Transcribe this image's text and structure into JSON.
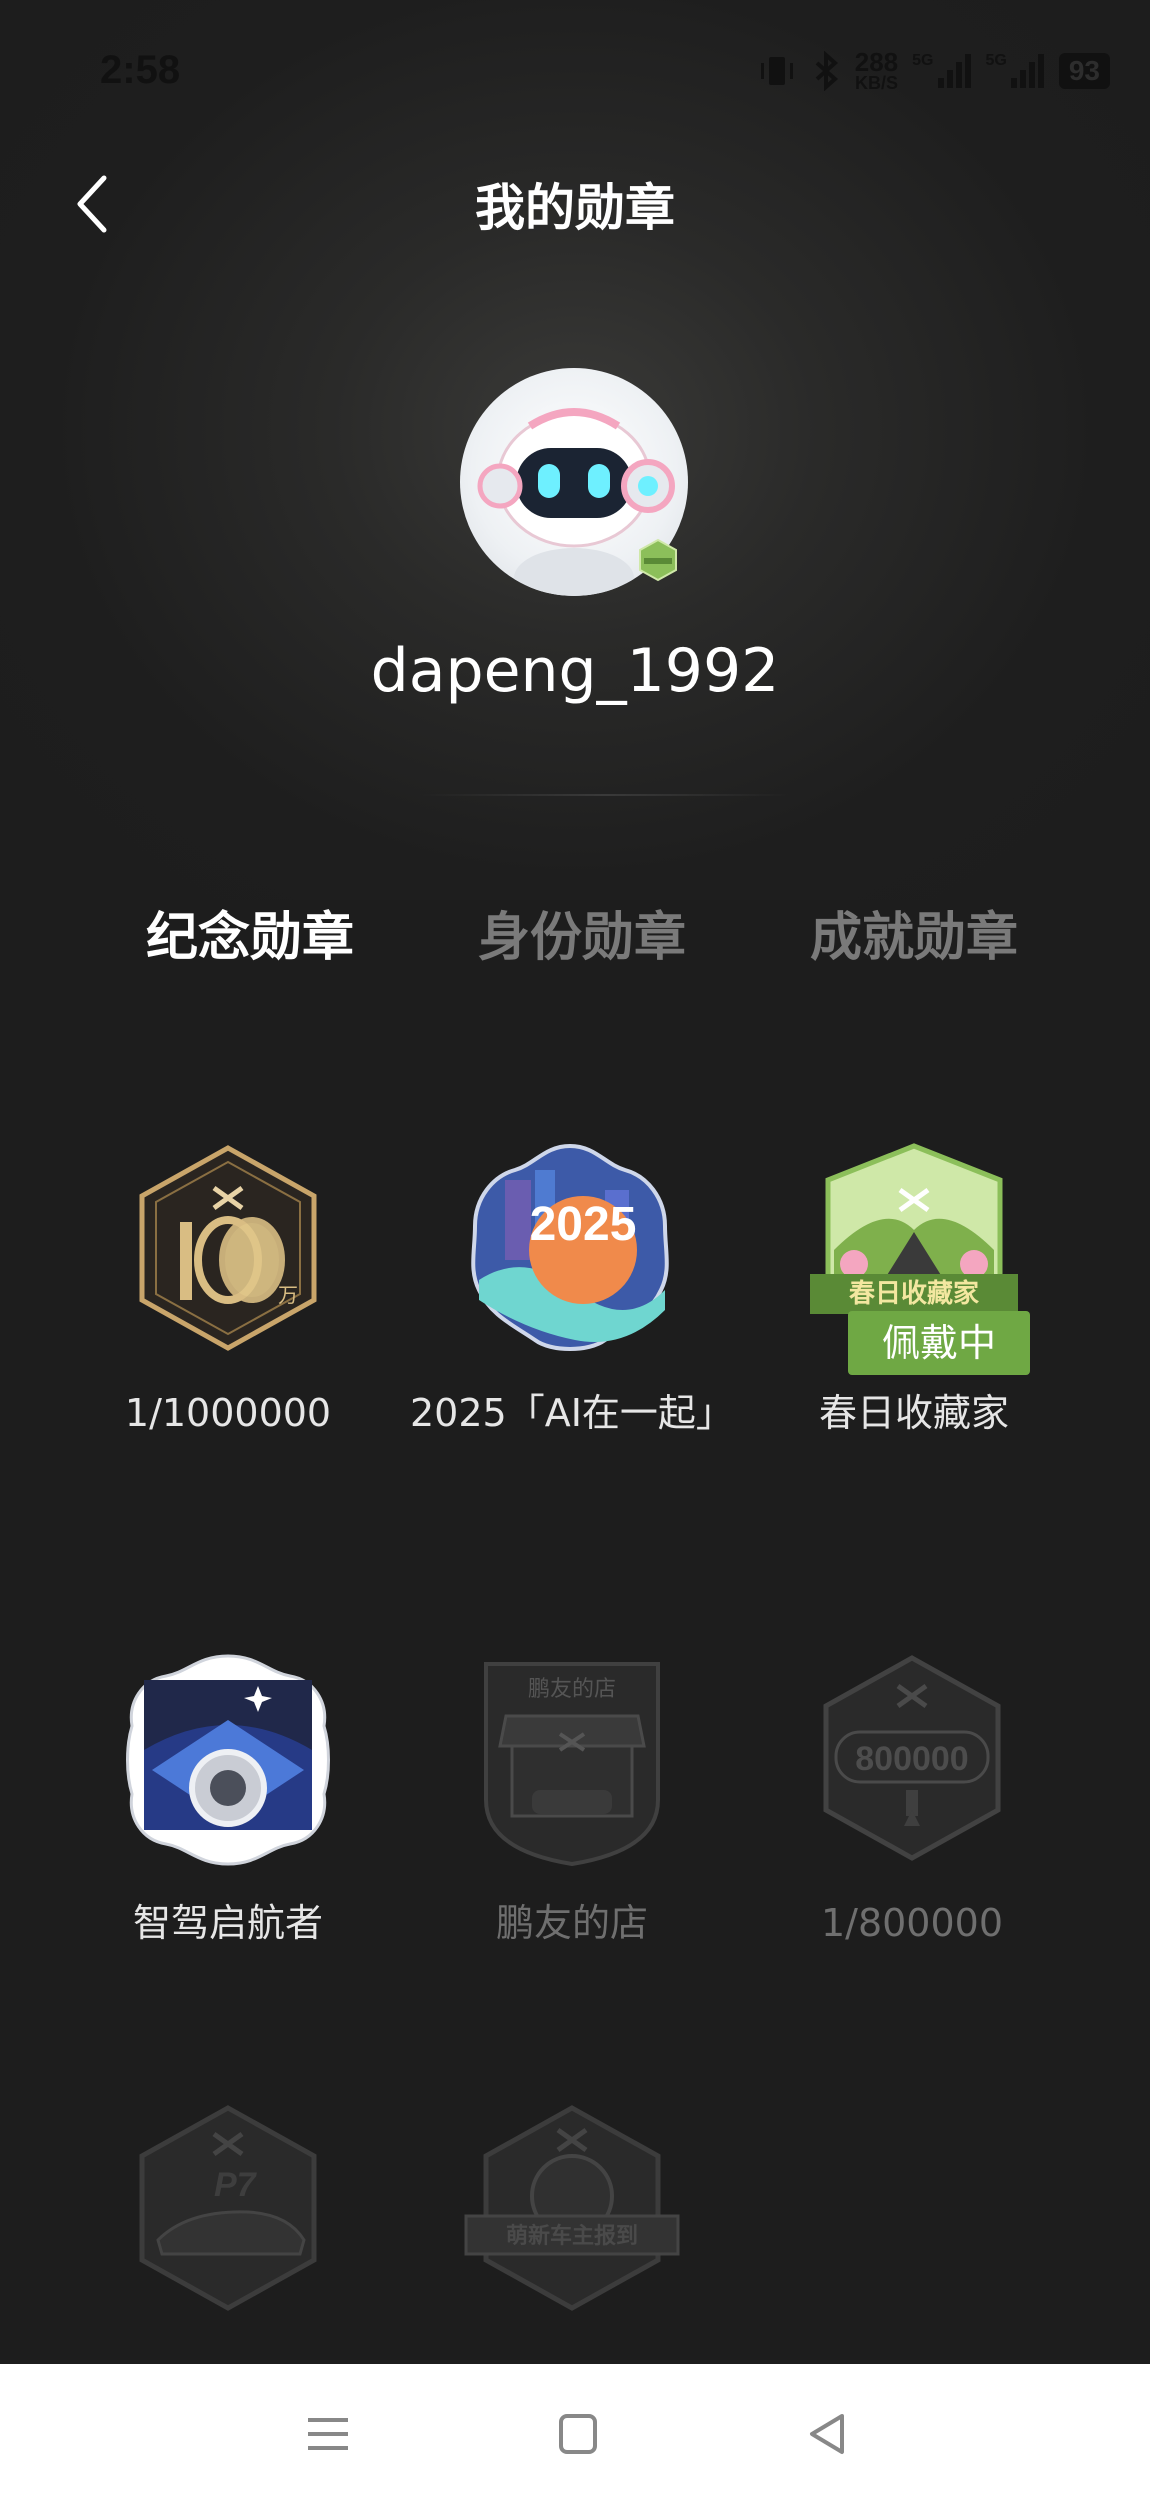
{
  "status_bar": {
    "time": "2:58",
    "speed_value": "288",
    "speed_unit": "KB/S",
    "signal_1": "5G",
    "signal_2": "5G",
    "battery": "93"
  },
  "header": {
    "title": "我的勋章",
    "back_icon": "chevron-left-icon"
  },
  "profile": {
    "username": "dapeng_1992"
  },
  "tabs": [
    {
      "label": "纪念勋章",
      "active": true
    },
    {
      "label": "身份勋章",
      "active": false
    },
    {
      "label": "成就勋章",
      "active": false
    }
  ],
  "badges": [
    {
      "label": "1/1000000",
      "earned": true,
      "badge_text": "万"
    },
    {
      "label": "2025「AI在一起」",
      "earned": true,
      "badge_text": "2025"
    },
    {
      "label": "春日收藏家",
      "earned": true,
      "badge_text": "春日收藏家",
      "wearing": "佩戴中"
    },
    {
      "label": "智驾启航者",
      "earned": true
    },
    {
      "label": "鹏友的店",
      "earned": false,
      "badge_text": "鹏友的店"
    },
    {
      "label": "1/800000",
      "earned": false,
      "badge_text": "800000"
    },
    {
      "label": "",
      "earned": false,
      "badge_text": "P7"
    },
    {
      "label": "",
      "earned": false,
      "badge_text": "萌新车主报到"
    }
  ],
  "colors": {
    "background": "#1d1d1d",
    "wearing_badge": "#6fa844",
    "tab_active": "#ffffff",
    "tab_inactive": "#7a7a7a"
  },
  "navbar": {
    "icons": [
      "menu-icon",
      "home-square-icon",
      "back-triangle-icon"
    ]
  }
}
